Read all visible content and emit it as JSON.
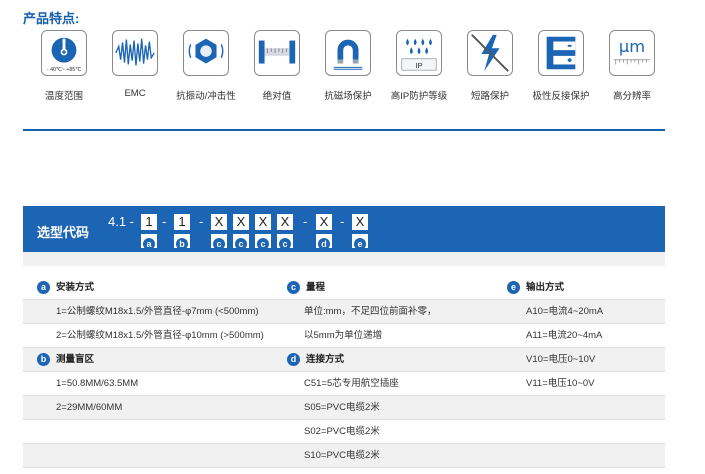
{
  "section_title": "产品特点:",
  "features": [
    {
      "icon": "thermometer-icon",
      "label": "温度范围",
      "sub": "- 40℃~ +85℃"
    },
    {
      "icon": "emc-wave-icon",
      "label": "EMC"
    },
    {
      "icon": "vibration-nut-icon",
      "label": "抗振动/冲击性"
    },
    {
      "icon": "absolute-scale-icon",
      "label": "绝对值"
    },
    {
      "icon": "magnet-icon",
      "label": "抗磁场保护"
    },
    {
      "icon": "ip-drops-icon",
      "label": "高IP防护等级",
      "sub": "IP"
    },
    {
      "icon": "lightning-icon",
      "label": "短路保护"
    },
    {
      "icon": "polarity-icon",
      "label": "极性反接保护"
    },
    {
      "icon": "micrometer-icon",
      "label": "高分辨率",
      "sub": "μm"
    }
  ],
  "code": {
    "title": "选型代码",
    "prefix": "4.1 -",
    "slots": [
      {
        "value": "1",
        "badge": "a"
      },
      {
        "value": "1",
        "badge": "b"
      },
      {
        "value": "X",
        "badge": "c"
      },
      {
        "value": "X",
        "badge": "c"
      },
      {
        "value": "X",
        "badge": "c"
      },
      {
        "value": "X",
        "badge": "c"
      },
      {
        "value": "X",
        "badge": "d"
      },
      {
        "value": "X",
        "badge": "e"
      }
    ],
    "dash": "-"
  },
  "table": {
    "col_a": {
      "badge": "a",
      "title": "安装方式",
      "items": [
        "1=公制螺纹M18x1.5/外管直径-φ7mm (<500mm)",
        "2=公制螺纹M18x1.5/外管直径-φ10mm (>500mm)"
      ]
    },
    "col_b": {
      "badge": "b",
      "title": "测量盲区",
      "items": [
        "1=50.8MM/63.5MM",
        "2=29MM/60MM"
      ]
    },
    "col_c": {
      "badge": "c",
      "title": "量程",
      "items": [
        "单位:mm，不足四位前面补零，",
        "以5mm为单位递增"
      ]
    },
    "col_d": {
      "badge": "d",
      "title": "连接方式",
      "items": [
        "C51=5芯专用航空插座",
        "S05=PVC电缆2米",
        "S02=PVC电缆2米",
        "S10=PVC电缆2米"
      ]
    },
    "col_e": {
      "badge": "e",
      "title": "输出方式",
      "items": [
        "A10=电流4~20mA",
        "A11=电流20~4mA",
        "V10=电压0~10V",
        "V11=电压10~0V"
      ]
    }
  },
  "colors": {
    "brand_blue": "#1c64b4",
    "title_blue": "#1560ad"
  }
}
